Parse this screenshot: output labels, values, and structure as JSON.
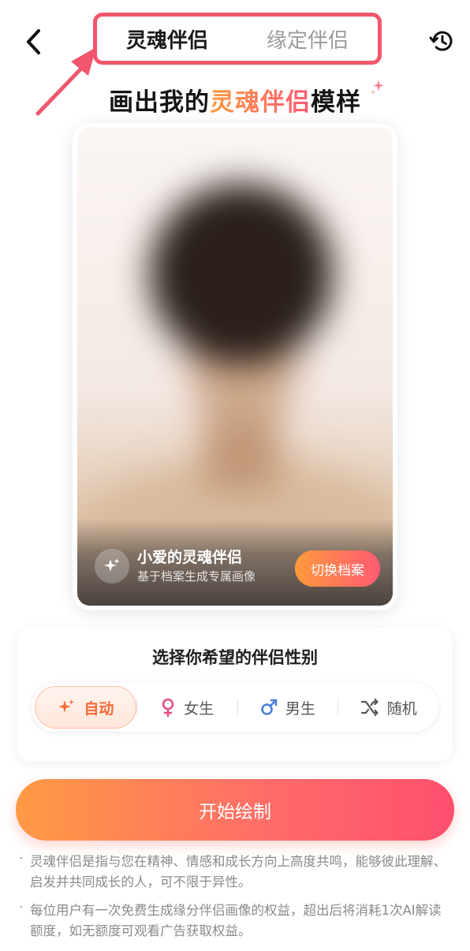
{
  "header": {
    "back_icon": "back-arrow-icon",
    "history_icon": "history-icon",
    "tabs": [
      {
        "label": "灵魂伴侣",
        "active": true
      },
      {
        "label": "缘定伴侣",
        "active": false
      }
    ],
    "highlight_color": "#f0566d"
  },
  "headline": {
    "prefix": "画出我的",
    "highlight": "灵魂伴侣",
    "suffix": "模样"
  },
  "card": {
    "name": "小爱的灵魂伴侣",
    "subtitle": "基于档案生成专属画像",
    "switch_label": "切换档案",
    "icon": "sparkle-icon"
  },
  "gender": {
    "title": "选择你希望的伴侣性别",
    "options": [
      {
        "label": "自动",
        "icon": "sparkle-icon",
        "active": true
      },
      {
        "label": "女生",
        "icon": "female-icon",
        "active": false
      },
      {
        "label": "男生",
        "icon": "male-icon",
        "active": false
      },
      {
        "label": "随机",
        "icon": "shuffle-icon",
        "active": false
      }
    ]
  },
  "start_button": "开始绘制",
  "notes": [
    "灵魂伴侣是指与您在精神、情感和成长方向上高度共鸣，能够彼此理解、启发并共同成长的人，可不限于异性。",
    "每位用户有一次免费生成缘分伴侣画像的权益，超出后将消耗1次AI解读额度，如无额度可观看广告获取权益。"
  ],
  "colors": {
    "accent_orange": "#ff9a3c",
    "accent_pink": "#ff5a72",
    "female": "#e84d8a",
    "male": "#4a7de0"
  }
}
